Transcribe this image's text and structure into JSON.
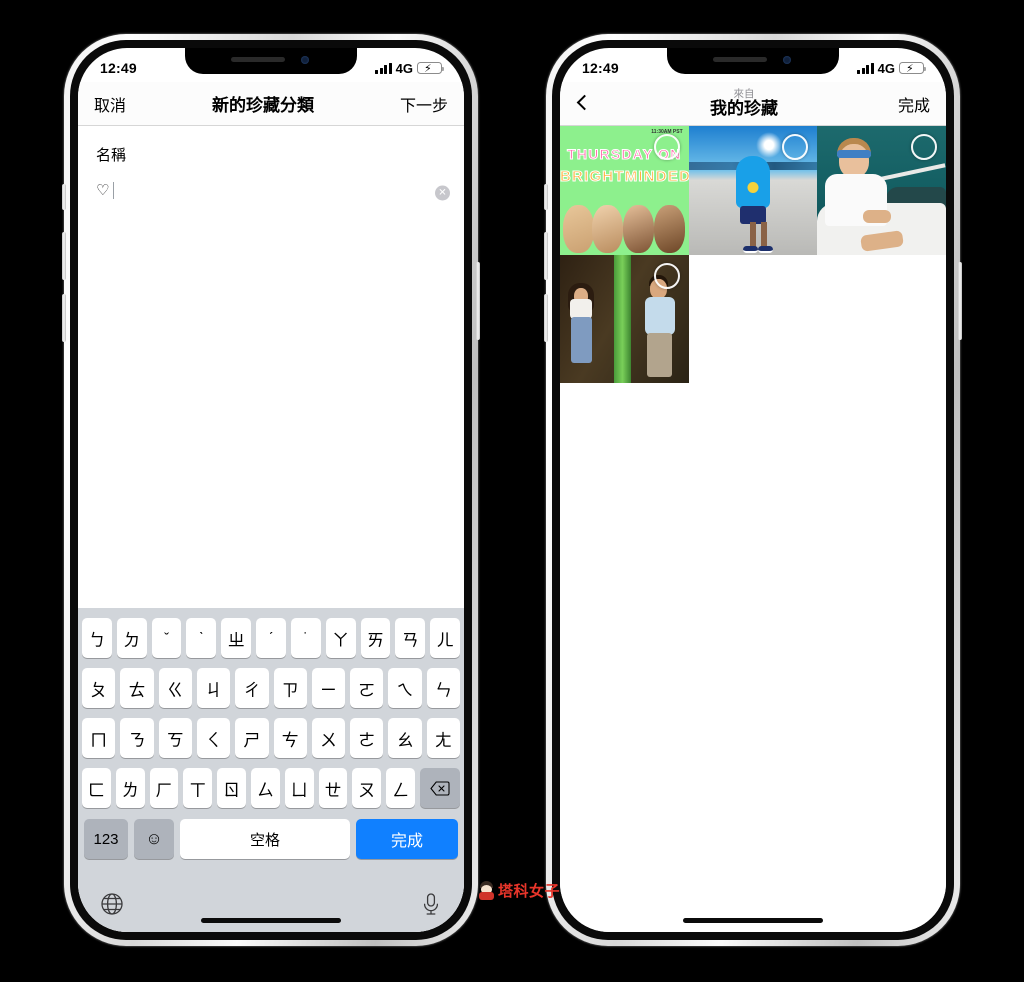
{
  "watermark": {
    "text": "塔科女子",
    "icon": "mascot-icon",
    "color": "#e8352a"
  },
  "left_phone": {
    "status": {
      "time": "12:49",
      "network": "4G",
      "signal_icon": "signal-bars-icon",
      "battery_icon": "battery-charging-icon",
      "battery_color": "#f7cf32"
    },
    "navbar": {
      "cancel": "取消",
      "title": "新的珍藏分類",
      "next": "下一步"
    },
    "form": {
      "field_label": "名稱",
      "field_value": "♡",
      "field_placeholder": "名稱",
      "clear_icon": "clear-circle-icon"
    },
    "keyboard": {
      "rows": [
        [
          "ㄅ",
          "ㄉ",
          "ˇ",
          "ˋ",
          "ㄓ",
          "ˊ",
          "˙",
          "ㄚ",
          "ㄞ",
          "ㄢ",
          "ㄦ"
        ],
        [
          "ㄆ",
          "ㄊ",
          "ㄍ",
          "ㄐ",
          "ㄔ",
          "ㄗ",
          "ㄧ",
          "ㄛ",
          "ㄟ",
          "ㄣ"
        ],
        [
          "ㄇ",
          "ㄋ",
          "ㄎ",
          "ㄑ",
          "ㄕ",
          "ㄘ",
          "ㄨ",
          "ㄜ",
          "ㄠ",
          "ㄤ"
        ],
        [
          "ㄈ",
          "ㄌ",
          "ㄏ",
          "ㄒ",
          "ㄖ",
          "ㄙ",
          "ㄩ",
          "ㄝ",
          "ㄡ",
          "ㄥ"
        ]
      ],
      "backspace_icon": "backspace-icon",
      "numbers_key": "123",
      "emoji_key": "☺",
      "space_key": "空格",
      "enter_key": "完成",
      "enter_color": "#1080ff",
      "globe_icon": "globe-icon",
      "mic_icon": "microphone-icon"
    }
  },
  "right_phone": {
    "status": {
      "time": "12:49",
      "network": "4G",
      "signal_icon": "signal-bars-icon",
      "battery_icon": "battery-charging-icon",
      "battery_color": "#f7cf32"
    },
    "navbar": {
      "back_icon": "chevron-left-icon",
      "supertitle": "來自",
      "title": "我的珍藏",
      "done": "完成"
    },
    "grid": {
      "items": [
        {
          "id": "poster",
          "alt": "綠色海報",
          "line1": "THURSDAY ON",
          "line2": "BRIGHTMINDED",
          "stamp": "11:30AM PST",
          "selected": false
        },
        {
          "id": "hoodie",
          "alt": "藍色連帽衫",
          "selected": false
        },
        {
          "id": "boat",
          "alt": "船上的人",
          "selected": false
        },
        {
          "id": "couple",
          "alt": "樹旁的兩個人",
          "selected": false
        }
      ],
      "selection_icon": "selection-circle-icon"
    }
  }
}
